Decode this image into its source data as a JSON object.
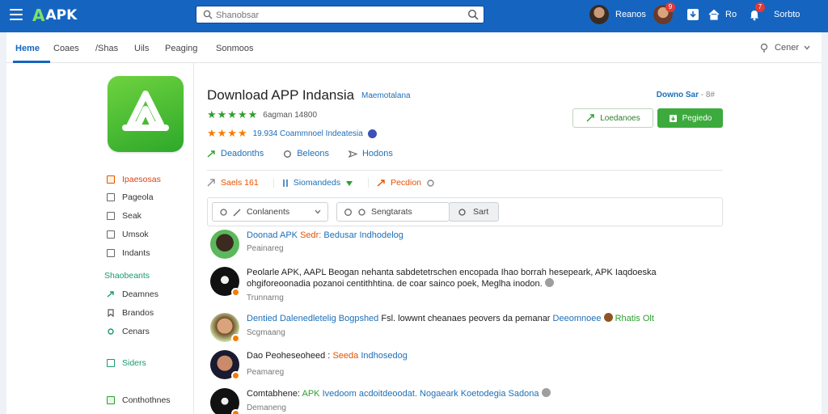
{
  "header": {
    "logo_mark": "A",
    "logo_text": "APK",
    "search_placeholder": "Shanobsar",
    "user1_name": "Reanos",
    "user2_badge": "9",
    "nav_label": "Ro",
    "notif_badge": "7",
    "notif_label": "Sorbto"
  },
  "nav": {
    "tabs": [
      {
        "label": "Heme"
      },
      {
        "label": "Coaes"
      },
      {
        "label": "/Shas"
      },
      {
        "label": "Uils"
      },
      {
        "label": "Peaging"
      },
      {
        "label": "Sonmoos"
      }
    ],
    "center_dropdown": "Cener"
  },
  "sidebar": {
    "items": [
      {
        "label": "Ipaesosas"
      },
      {
        "label": "Pageola"
      },
      {
        "label": "Seak"
      },
      {
        "label": "Umsok"
      },
      {
        "label": "Indants"
      }
    ],
    "section_heading": "Shaobeants",
    "sub_items": [
      {
        "label": "Deamnes"
      },
      {
        "label": "Brandos"
      },
      {
        "label": "Cenars"
      }
    ],
    "extra_item": "Siders",
    "bottom_item": "Conthothnes"
  },
  "app": {
    "title": "Download APP Indansia",
    "title_tag": "Maemotalana",
    "rating1_text": "6agman 14800",
    "rating2_text": "19.934 Coammnoel Indeatesia",
    "links": [
      "Deadonths",
      "Beleons",
      "Hodons"
    ],
    "meta": {
      "size": "Saels 161",
      "publisher": "Siomandeds",
      "flag": "Pecdion"
    },
    "download_label": "Downo Sar",
    "download_suffix": "- 8#",
    "btn_outline": "Loedanoes",
    "btn_solid": "Pegiedo"
  },
  "filters": {
    "select1": "Conlanents",
    "select2": "Sengtarats",
    "sort": "Sart"
  },
  "comments": [
    {
      "name": "Doonad APK",
      "tag": "Sedr:",
      "text": "Indhodelog",
      "extra": "Bedusar",
      "sub": "Peainareg"
    },
    {
      "name": "Peolarle APK, AAPL Beogan",
      "text": "nehanta sabdetetrschen encopada Ihao borrah  hesepeark, APK Iaqdoeska ohgiforeoonadia pozanoi centithhtina. de coar sainco poek, Meglha inodon.",
      "sub": "Trunnarng"
    },
    {
      "name": "Dentied Dalenedletelig",
      "tag": "Bogpshed",
      "text": "Fsl. lowwnt cheanaes peovers da pemanar",
      "extra": "Deeomnoee",
      "extra2": "Rhatis Olt",
      "sub": "Scgmaang"
    },
    {
      "name": "Dao Peoheseoheed :",
      "tag": "Seeda",
      "text": "Indhosedog",
      "sub": "Peamareg"
    },
    {
      "name": "Comtabhene:",
      "tag": "APK",
      "text": "Ivedoom acdoitdeoodat. Nogaeark Koetodegia Sadona",
      "sub": "Demaneng"
    }
  ],
  "colors": {
    "topbar": "#1565c0",
    "accent_green": "#3daa3d",
    "link_blue": "#1e6fb8",
    "orange": "#f57c00"
  }
}
